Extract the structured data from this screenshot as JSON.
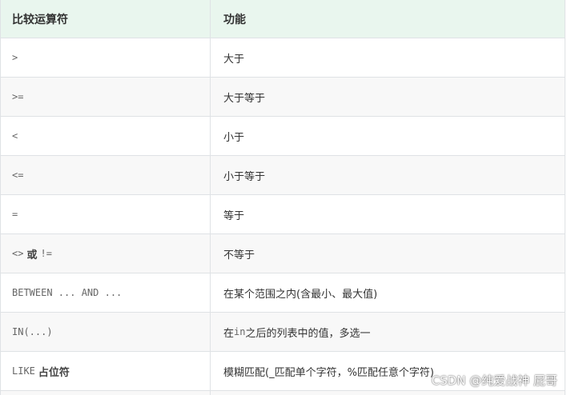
{
  "table": {
    "headers": {
      "operator": "比较运算符",
      "function": "功能"
    },
    "rows": [
      {
        "op_code": ">",
        "op_text": "",
        "op_code2": "",
        "function": "大于"
      },
      {
        "op_code": ">=",
        "op_text": "",
        "op_code2": "",
        "function": "大于等于"
      },
      {
        "op_code": "<",
        "op_text": "",
        "op_code2": "",
        "function": "小于"
      },
      {
        "op_code": "<=",
        "op_text": "",
        "op_code2": "",
        "function": "小于等于"
      },
      {
        "op_code": "=",
        "op_text": "",
        "op_code2": "",
        "function": "等于"
      },
      {
        "op_code": "<>",
        "op_text": "或",
        "op_code2": "!=",
        "function": "不等于"
      },
      {
        "op_code": "BETWEEN ... AND ...",
        "op_text": "",
        "op_code2": "",
        "function": "在某个范围之内(含最小、最大值)"
      },
      {
        "op_code": "IN(...)",
        "op_text": "",
        "op_code2": "",
        "function_pre": "在",
        "function_code": "in",
        "function_post": "之后的列表中的值，多选一"
      },
      {
        "op_code": "LIKE",
        "op_text": "占位符",
        "op_code2": "",
        "function": "模糊匹配(_匹配单个字符，%匹配任意个字符)"
      }
    ]
  },
  "watermark": "CSDN @纯爱战神 屁哥",
  "colors": {
    "header_bg": "#e9f6ee",
    "alt_row_bg": "#f8f8f8",
    "border": "#dfe2e5"
  }
}
